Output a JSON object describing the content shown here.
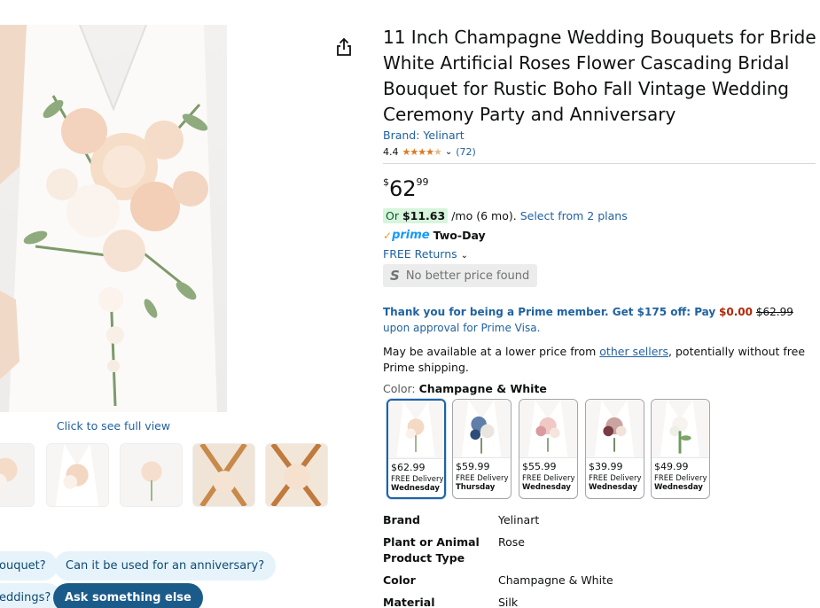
{
  "product": {
    "title": "11 Inch Champagne Wedding Bouquets for Bride White Artificial Roses Flower Cascading Bridal Bouquet for Rustic Boho Fall Vintage Wedding Ceremony Party and Anniversary",
    "brand_link": "Brand: Yelinart",
    "rating": "4.4",
    "rating_count": "(72)",
    "price": {
      "symbol": "$",
      "whole": "62",
      "fraction": "99"
    }
  },
  "gallery": {
    "full_view_label": "Click to see full view"
  },
  "installment": {
    "prefix": "Or",
    "amount": "$11.63",
    "suffix": "/mo (6 mo).",
    "plans_link": "Select from 2 plans"
  },
  "prime": {
    "logo": "prime",
    "label": "Two-Day",
    "returns_link": "FREE Returns"
  },
  "price_badge": {
    "letter": "S",
    "text": "No better price found"
  },
  "prime_offer": {
    "text_a": "Thank you for being a Prime member. Get $175 off: Pay",
    "pay_amount": "$0.00",
    "old_price": "$62.99",
    "text_b": "upon approval for Prime Visa."
  },
  "other_sellers": {
    "text_a": "May be available at a lower price from",
    "link": "other sellers",
    "text_b": ", potentially without free Prime shipping."
  },
  "color": {
    "label": "Color:",
    "selected": "Champagne & White",
    "options": [
      {
        "price": "$62.99",
        "delivery": "FREE Delivery",
        "day": "Wednesday"
      },
      {
        "price": "$59.99",
        "delivery": "FREE Delivery",
        "day": "Thursday"
      },
      {
        "price": "$55.99",
        "delivery": "FREE Delivery",
        "day": "Wednesday"
      },
      {
        "price": "$39.99",
        "delivery": "FREE Delivery",
        "day": "Wednesday"
      },
      {
        "price": "$49.99",
        "delivery": "FREE Delivery",
        "day": "Wednesday"
      }
    ]
  },
  "specs": [
    {
      "key": "Brand",
      "value": "Yelinart"
    },
    {
      "key": "Plant or Animal Product Type",
      "value": "Rose"
    },
    {
      "key": "Color",
      "value": "Champagne & White"
    },
    {
      "key": "Material",
      "value": "Silk"
    }
  ],
  "chips": {
    "c1": "ouquet?",
    "c2": "Can it be used for an anniversary?",
    "c3": "eddings?",
    "c4": "Ask something else"
  },
  "colors": {
    "link": "#2162a1",
    "price_red": "#b12704",
    "star": "#de7921",
    "prime_blue": "#1399ff",
    "chip_bg": "#e6f3fb",
    "chip_dark": "#1b5b8a"
  }
}
